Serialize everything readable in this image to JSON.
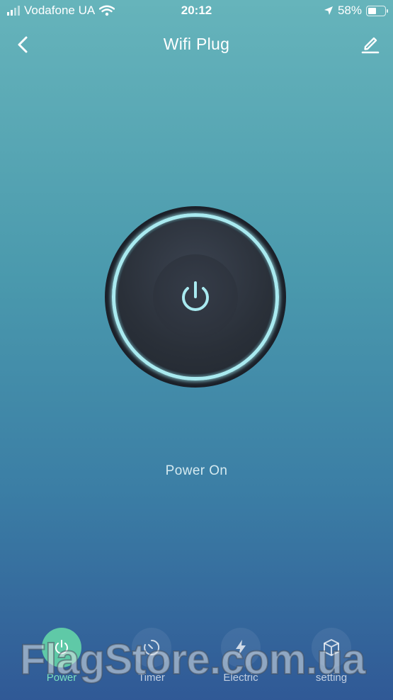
{
  "status_bar": {
    "carrier": "Vodafone UA",
    "time": "20:12",
    "battery": "58%",
    "battery_level": 0.58,
    "icons": [
      "signal-icon",
      "wifi-icon",
      "location-arrow-icon",
      "battery-icon"
    ]
  },
  "header": {
    "title": "Wifi Plug",
    "back_icon": "chevron-left-icon",
    "edit_icon": "pencil-icon"
  },
  "power": {
    "status": "Power On",
    "icon": "power-icon",
    "ring_color": "#a9eaf0"
  },
  "tabs": [
    {
      "label": "Power",
      "icon": "power-icon",
      "active": true
    },
    {
      "label": "Timer",
      "icon": "timer-icon",
      "active": false
    },
    {
      "label": "Electric",
      "icon": "lightning-icon",
      "active": false
    },
    {
      "label": "setting",
      "icon": "cube-icon",
      "active": false
    }
  ],
  "watermark": "FlagStore.com.ua",
  "colors": {
    "accent": "#5fc9a7",
    "accent_label": "#7be0c0",
    "background_top": "#66b4bb",
    "background_bottom": "#305996"
  }
}
